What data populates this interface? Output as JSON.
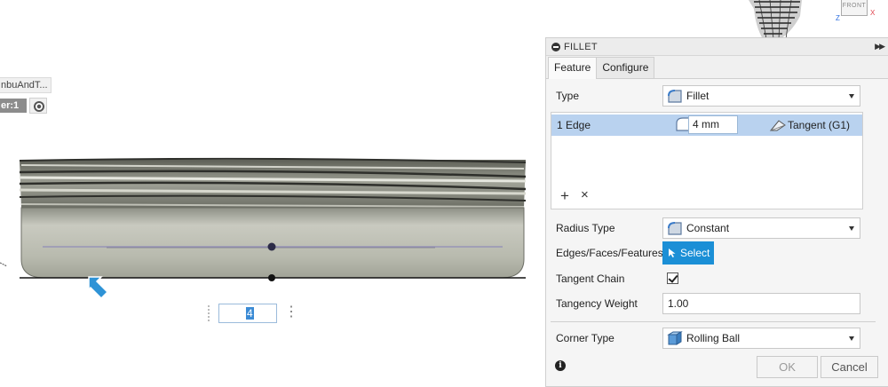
{
  "viewport": {
    "browser_item_label": "nbuAndT...",
    "counter_label": "er:1",
    "value_input": "4",
    "viewcube_face": "FRONT",
    "axis_z": "Z",
    "axis_x": "X"
  },
  "panel": {
    "title": "FILLET",
    "tabs": [
      {
        "label": "Feature",
        "active": true
      },
      {
        "label": "Configure",
        "active": false
      }
    ],
    "type": {
      "label": "Type",
      "value": "Fillet",
      "icon": "fillet-icon"
    },
    "edge_list": {
      "rows": [
        {
          "name": "1 Edge",
          "radius": "4 mm",
          "continuity": "Tangent (G1)"
        }
      ],
      "add_glyph": "+",
      "remove_glyph": "×"
    },
    "radius_type": {
      "label": "Radius Type",
      "value": "Constant"
    },
    "edges_faces_features": {
      "label": "Edges/Faces/Features",
      "button": "Select"
    },
    "tangent_chain": {
      "label": "Tangent Chain",
      "checked": true
    },
    "tangency_weight": {
      "label": "Tangency Weight",
      "value": "1.00"
    },
    "corner_type": {
      "label": "Corner Type",
      "value": "Rolling Ball"
    },
    "ok_label": "OK",
    "cancel_label": "Cancel"
  },
  "colors": {
    "accent": "#1b8fd6",
    "selection_row": "#b9d2ef",
    "model_body": "#b3b5a8"
  }
}
